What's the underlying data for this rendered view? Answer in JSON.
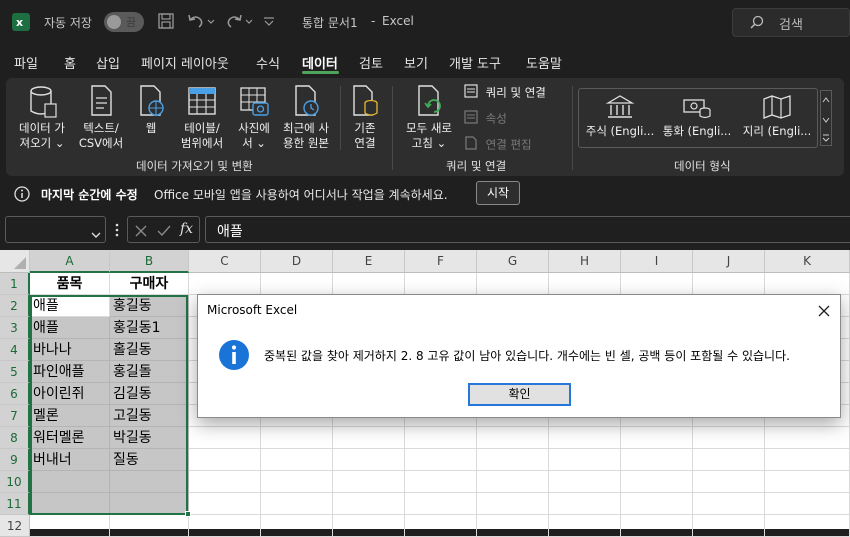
{
  "titlebar": {
    "autosave_label": "자동 저장",
    "autosave_state": "끔",
    "document_title": "통합 문서1",
    "separator": "-",
    "app_name": "Excel",
    "search_placeholder": "검색"
  },
  "tabs": [
    "파일",
    "홈",
    "삽입",
    "페이지 레이아웃",
    "수식",
    "데이터",
    "검토",
    "보기",
    "개발 도구",
    "도움말"
  ],
  "active_tab": "데이터",
  "ribbon": {
    "get_data": {
      "line1": "데이터 가",
      "line2": "져오기 ⌄"
    },
    "text_csv": {
      "line1": "텍스트/",
      "line2": "CSV에서"
    },
    "web": {
      "line1": "웹"
    },
    "table_range": {
      "line1": "테이블/",
      "line2": "범위에서"
    },
    "from_picture": {
      "line1": "사진에",
      "line2": "서 ⌄"
    },
    "recent_sources": {
      "line1": "최근에 사",
      "line2": "용한 원본"
    },
    "existing_conn": {
      "line1": "기존",
      "line2": "연결"
    },
    "group1_label": "데이터 가져오기 및 변환",
    "refresh_all": {
      "line1": "모두 새로",
      "line2": "고침 ⌄"
    },
    "queries_conn": "쿼리 및 연결",
    "properties": "속성",
    "edit_links": "연결 편집",
    "group2_label": "쿼리 및 연결",
    "stocks": "주식 (Engli...",
    "currency": "통화 (Engli...",
    "geography": "지리 (Engli...",
    "group3_label": "데이터 형식"
  },
  "infobar": {
    "bold_text": "마지막 순간에 수정",
    "message": "Office 모바일 앱을 사용하여 어디서나 작업을 계속하세요.",
    "button": "시작"
  },
  "formula_bar": {
    "namebox": "",
    "fx": "fx",
    "content": "애플"
  },
  "columns": [
    "A",
    "B",
    "C",
    "D",
    "E",
    "F",
    "G",
    "H",
    "I",
    "J",
    "K"
  ],
  "rows": [
    "1",
    "2",
    "3",
    "4",
    "5",
    "6",
    "7",
    "8",
    "9",
    "10",
    "11",
    "12"
  ],
  "sheet": {
    "headers": [
      "품목",
      "구매자"
    ],
    "data": [
      [
        "애플",
        "홍길동"
      ],
      [
        "애플",
        "홍길동1"
      ],
      [
        "바나나",
        "홀길동"
      ],
      [
        "파인애플",
        "홍길돌"
      ],
      [
        "아이린쥐",
        "김길동"
      ],
      [
        "멜론",
        "고길동"
      ],
      [
        "워터멜론",
        "박길동"
      ],
      [
        "버내너",
        "질동"
      ]
    ]
  },
  "dialog": {
    "title": "Microsoft Excel",
    "message": "중복된 값을 찾아 제거하지 2. 8 고유 값이 남아 있습니다. 개수에는 빈 셀, 공백 등이 포함될 수 있습니다.",
    "ok_label": "확인"
  },
  "colors": {
    "excel_green": "#217346",
    "accent_blue": "#0078d4",
    "selection_gray": "#c6c6c6"
  }
}
